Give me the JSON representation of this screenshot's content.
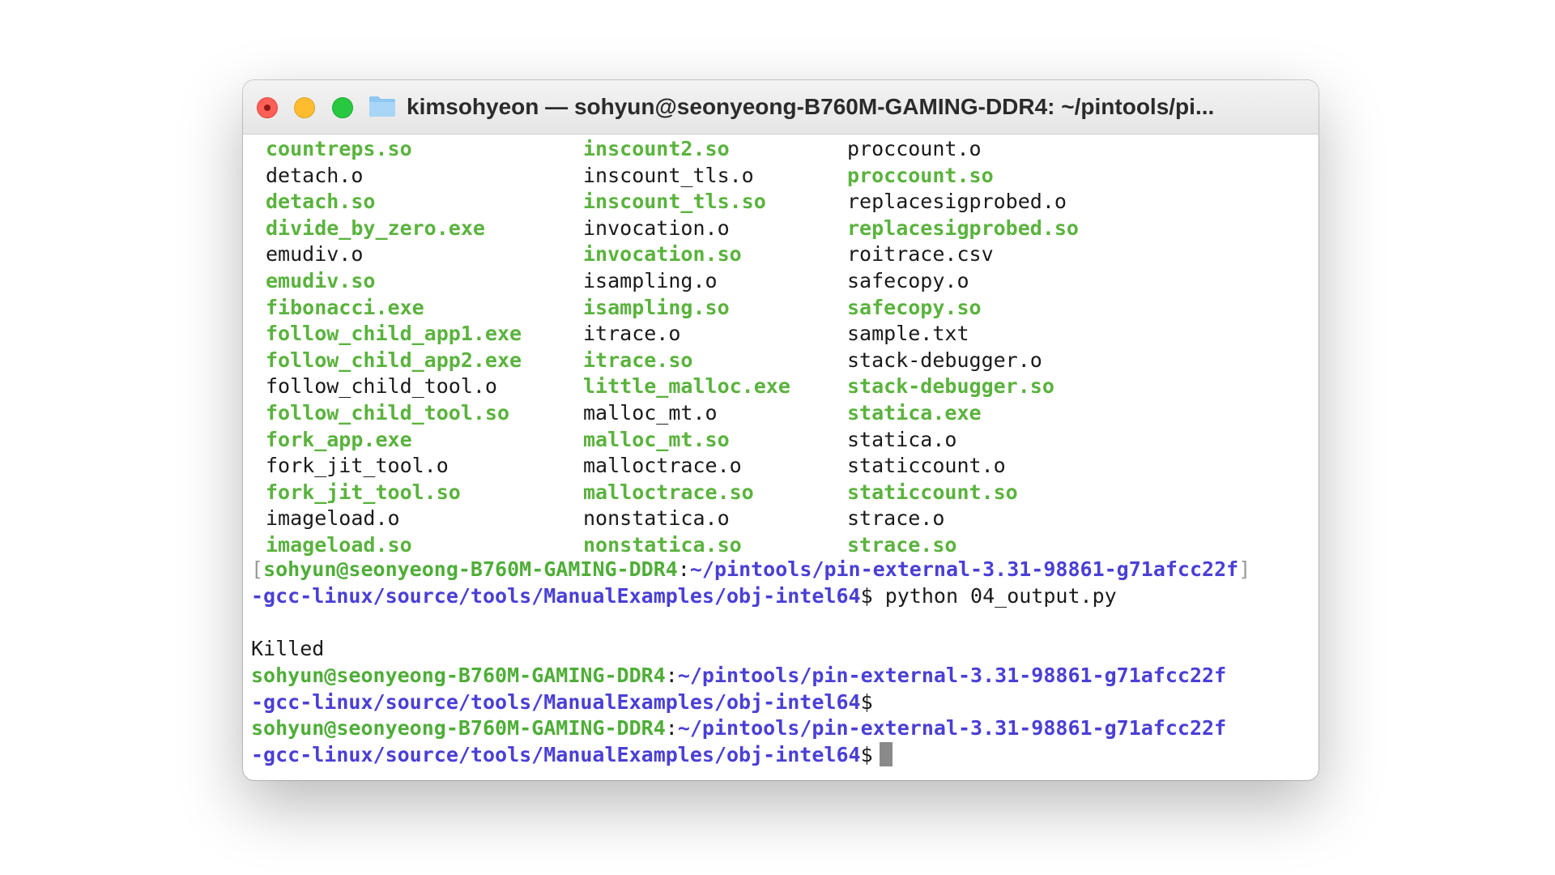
{
  "window": {
    "title": "kimsohyeon — sohyun@seonyeong-B760M-GAMING-DDR4: ~/pintools/pi...",
    "icons": {
      "close": "close-icon",
      "minimize": "minimize-icon",
      "maximize": "maximize-icon",
      "folder": "folder-icon"
    },
    "colors": {
      "close": "#fe5f57",
      "minimize": "#febc2e",
      "maximize": "#28c840",
      "executable": "#5ab33d",
      "path": "#4a3fd6"
    }
  },
  "listing": {
    "col1": [
      {
        "name": "countreps.so",
        "kind": "so"
      },
      {
        "name": "detach.o",
        "kind": "plain"
      },
      {
        "name": "detach.so",
        "kind": "so"
      },
      {
        "name": "divide_by_zero.exe",
        "kind": "exe"
      },
      {
        "name": "emudiv.o",
        "kind": "plain"
      },
      {
        "name": "emudiv.so",
        "kind": "so"
      },
      {
        "name": "fibonacci.exe",
        "kind": "exe"
      },
      {
        "name": "follow_child_app1.exe",
        "kind": "exe"
      },
      {
        "name": "follow_child_app2.exe",
        "kind": "exe"
      },
      {
        "name": "follow_child_tool.o",
        "kind": "plain"
      },
      {
        "name": "follow_child_tool.so",
        "kind": "so"
      },
      {
        "name": "fork_app.exe",
        "kind": "exe"
      },
      {
        "name": "fork_jit_tool.o",
        "kind": "plain"
      },
      {
        "name": "fork_jit_tool.so",
        "kind": "so"
      },
      {
        "name": "imageload.o",
        "kind": "plain"
      },
      {
        "name": "imageload.so",
        "kind": "so"
      }
    ],
    "col2": [
      {
        "name": "inscount2.so",
        "kind": "so"
      },
      {
        "name": "inscount_tls.o",
        "kind": "plain"
      },
      {
        "name": "inscount_tls.so",
        "kind": "so"
      },
      {
        "name": "invocation.o",
        "kind": "plain"
      },
      {
        "name": "invocation.so",
        "kind": "so"
      },
      {
        "name": "isampling.o",
        "kind": "plain"
      },
      {
        "name": "isampling.so",
        "kind": "so"
      },
      {
        "name": "itrace.o",
        "kind": "plain"
      },
      {
        "name": "itrace.so",
        "kind": "so"
      },
      {
        "name": "little_malloc.exe",
        "kind": "exe"
      },
      {
        "name": "malloc_mt.o",
        "kind": "plain"
      },
      {
        "name": "malloc_mt.so",
        "kind": "so"
      },
      {
        "name": "malloctrace.o",
        "kind": "plain"
      },
      {
        "name": "malloctrace.so",
        "kind": "so"
      },
      {
        "name": "nonstatica.o",
        "kind": "plain"
      },
      {
        "name": "nonstatica.so",
        "kind": "so"
      }
    ],
    "col3": [
      {
        "name": "proccount.o",
        "kind": "plain"
      },
      {
        "name": "proccount.so",
        "kind": "so"
      },
      {
        "name": "replacesigprobed.o",
        "kind": "plain"
      },
      {
        "name": "replacesigprobed.so",
        "kind": "so"
      },
      {
        "name": "roitrace.csv",
        "kind": "plain"
      },
      {
        "name": "safecopy.o",
        "kind": "plain"
      },
      {
        "name": "safecopy.so",
        "kind": "so"
      },
      {
        "name": "sample.txt",
        "kind": "plain"
      },
      {
        "name": "stack-debugger.o",
        "kind": "plain"
      },
      {
        "name": "stack-debugger.so",
        "kind": "so"
      },
      {
        "name": "statica.exe",
        "kind": "exe"
      },
      {
        "name": "statica.o",
        "kind": "plain"
      },
      {
        "name": "staticcount.o",
        "kind": "plain"
      },
      {
        "name": "staticcount.so",
        "kind": "so"
      },
      {
        "name": "strace.o",
        "kind": "plain"
      },
      {
        "name": "strace.so",
        "kind": "so"
      }
    ]
  },
  "prompt": {
    "user": "sohyun@seonyeong-B760M-GAMING-DDR4",
    "colon": ":",
    "path_line1": "~/pintools/pin-external-3.31-98861-g71afcc22f",
    "path_line2": "-gcc-linux/source/tools/ManualExamples/obj-intel64",
    "sign": "$"
  },
  "session": {
    "open_bracket": "[",
    "close_bracket": "]",
    "command": " python 04_output.py",
    "output": "Killed"
  }
}
